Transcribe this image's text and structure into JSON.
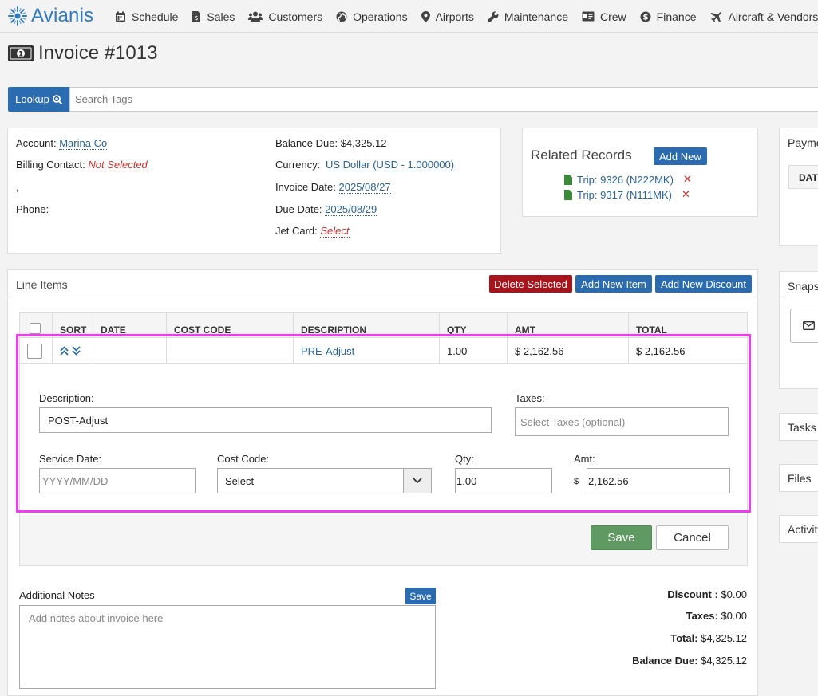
{
  "brand": "Avianis",
  "nav": [
    {
      "label": "Schedule",
      "icon": "calendar-icon"
    },
    {
      "label": "Sales",
      "icon": "file-dollar-icon"
    },
    {
      "label": "Customers",
      "icon": "users-icon"
    },
    {
      "label": "Operations",
      "icon": "globe-icon"
    },
    {
      "label": "Airports",
      "icon": "map-pin-icon"
    },
    {
      "label": "Maintenance",
      "icon": "wrench-icon"
    },
    {
      "label": "Crew",
      "icon": "id-card-icon"
    },
    {
      "label": "Finance",
      "icon": "dollar-circle-icon"
    },
    {
      "label": "Aircraft & Vendors",
      "icon": "plane-icon"
    }
  ],
  "page_title": "Invoice #1013",
  "lookup": {
    "button": "Lookup",
    "placeholder": "Search Tags"
  },
  "account": {
    "account_label": "Account:",
    "account_value": "Marina Co",
    "billing_label": "Billing Contact:",
    "billing_value": "Not Selected",
    "address": ",",
    "phone_label": "Phone:",
    "balance_label": "Balance Due:",
    "balance_value": "$4,325.12",
    "currency_label": "Currency:",
    "currency_value": "US Dollar (USD - 1.000000)",
    "invoice_date_label": "Invoice Date:",
    "invoice_date_value": "2025/08/27",
    "due_date_label": "Due Date:",
    "due_date_value": "2025/08/29",
    "jet_card_label": "Jet Card:",
    "jet_card_value": "Select"
  },
  "related": {
    "title": "Related Records",
    "add_new": "Add New",
    "items": [
      {
        "label": "Trip: 9326 (N222MK)"
      },
      {
        "label": "Trip: 9317 (N111MK)"
      }
    ]
  },
  "side_panels": [
    "Payments",
    "Snapshots",
    "Tasks",
    "Files",
    "Activity"
  ],
  "payments_col": "DATE",
  "line_items": {
    "title": "Line Items",
    "delete_selected": "Delete Selected",
    "add_item": "Add New Item",
    "add_discount": "Add New Discount",
    "columns": [
      "SORT",
      "DATE",
      "COST CODE",
      "DESCRIPTION",
      "QTY",
      "AMT",
      "TOTAL"
    ],
    "row": {
      "date": "",
      "cost_code": "",
      "description": "PRE-Adjust",
      "qty": "1.00",
      "amt": "$ 2,162.56",
      "total": "$ 2,162.56"
    },
    "edit": {
      "description_label": "Description:",
      "description_value": "POST-Adjust",
      "taxes_label": "Taxes:",
      "taxes_placeholder": "Select Taxes (optional)",
      "service_date_label": "Service Date:",
      "service_date_placeholder": "YYYY/MM/DD",
      "cost_code_label": "Cost Code:",
      "cost_code_value": "Select",
      "qty_label": "Qty:",
      "qty_value": "1.00",
      "amt_label": "Amt:",
      "amt_prefix": "$",
      "amt_value": "2,162.56",
      "save": "Save",
      "cancel": "Cancel"
    }
  },
  "notes": {
    "label": "Additional Notes",
    "save": "Save",
    "placeholder": "Add notes about invoice here"
  },
  "totals": {
    "discount_label": "Discount :",
    "discount_value": "$0.00",
    "taxes_label": "Taxes:",
    "taxes_value": "$0.00",
    "total_label": "Total:",
    "total_value": "$4,325.12",
    "balance_label": "Balance Due:",
    "balance_value": "$4,325.12"
  },
  "colors": {
    "accent": "#2b6bb0",
    "danger": "#a8141c",
    "success": "#5e9a62",
    "highlight": "#f03cf0",
    "brand": "#2f7bbf"
  }
}
